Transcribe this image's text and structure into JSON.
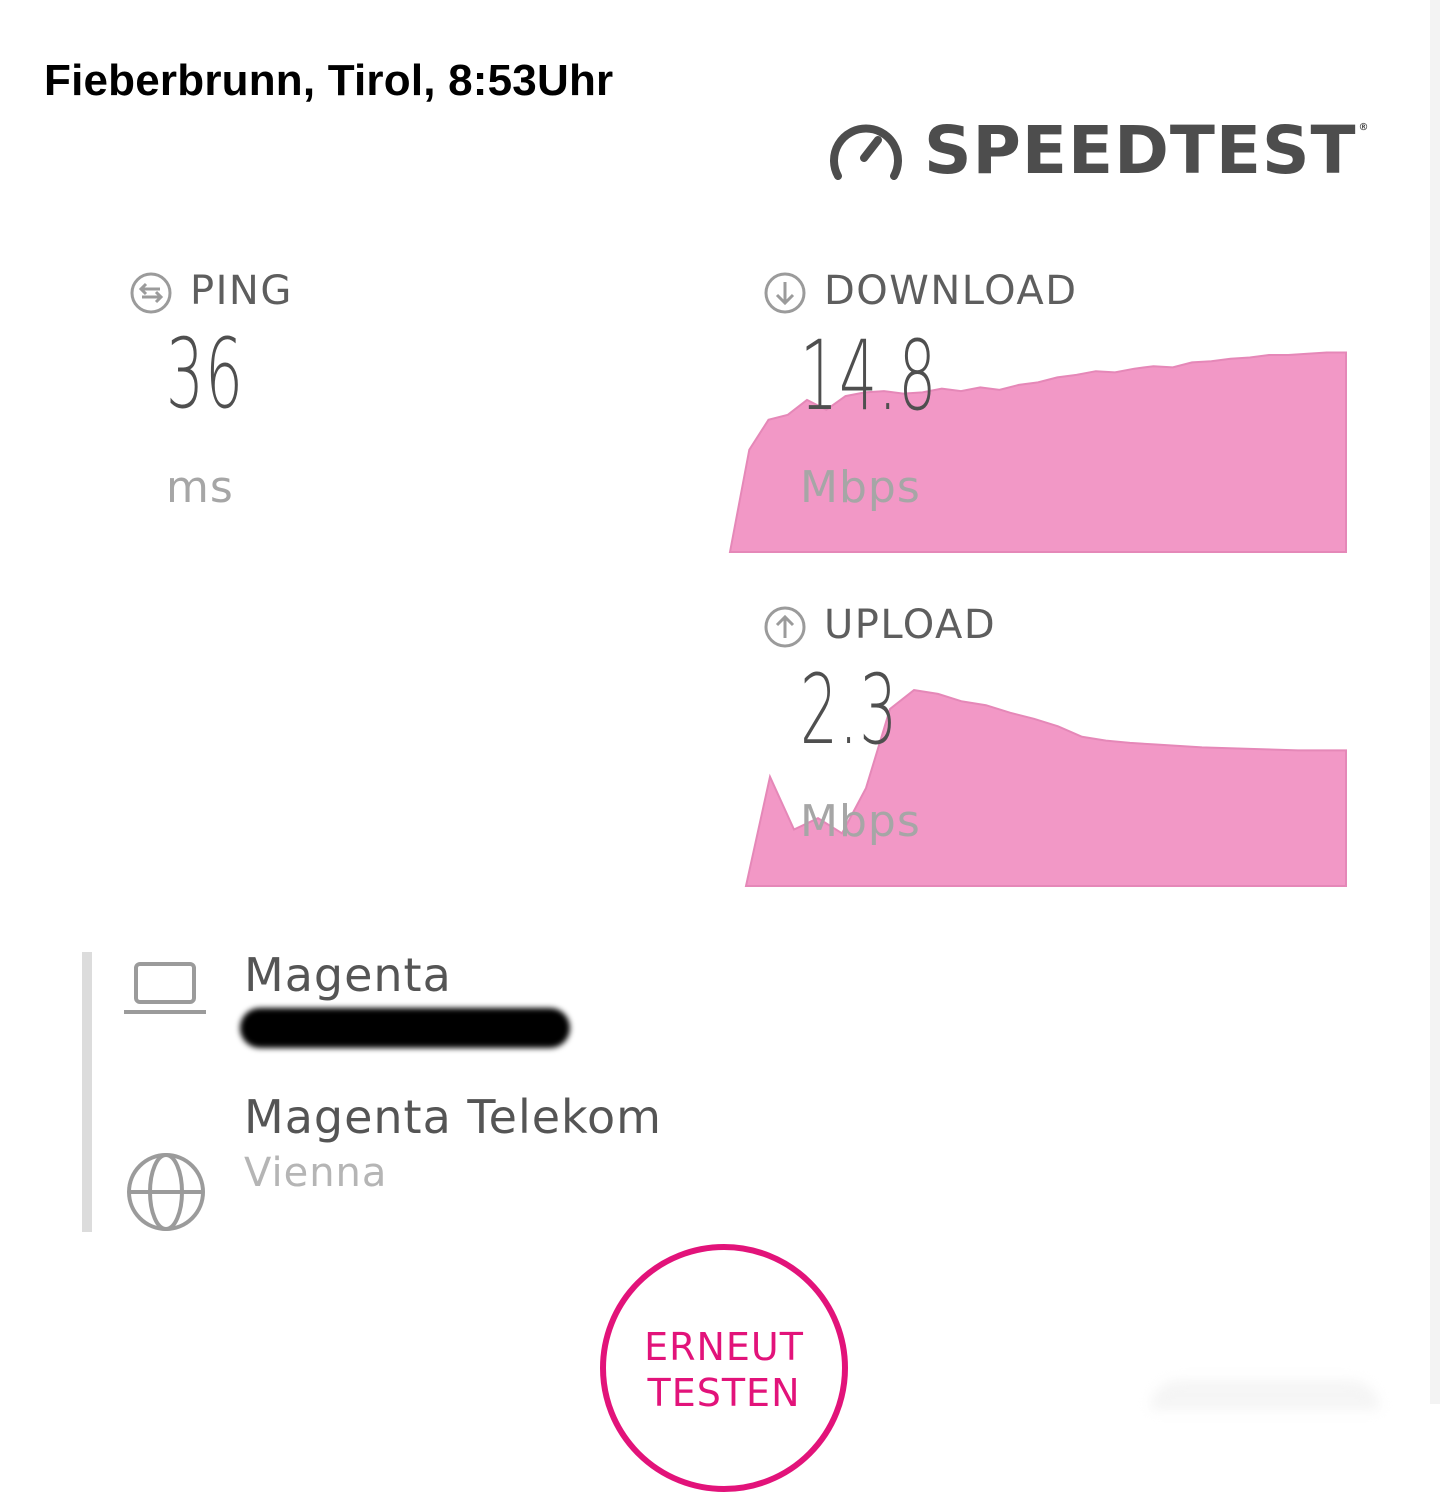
{
  "caption": "Fieberbrunn, Tirol, 8:53Uhr",
  "brand": {
    "name": "SPEEDTEST",
    "mark": "®",
    "icon": "gauge-icon"
  },
  "ping": {
    "label": "PING",
    "value": "36",
    "unit": "ms",
    "icon": "ping-arrows-icon"
  },
  "download": {
    "label": "DOWNLOAD",
    "value": "14.8",
    "unit": "Mbps",
    "icon": "arrow-down-circle-icon",
    "graph": [
      0,
      8.2,
      10.6,
      11.0,
      12.2,
      11.4,
      12.5,
      12.8,
      12.9,
      12.7,
      12.8,
      13.1,
      12.9,
      13.2,
      13.0,
      13.4,
      13.6,
      14.0,
      14.2,
      14.5,
      14.4,
      14.7,
      14.9,
      14.8,
      15.2,
      15.3,
      15.5,
      15.6,
      15.8,
      15.8,
      15.9,
      16.0,
      16.0
    ]
  },
  "upload": {
    "label": "UPLOAD",
    "value": "2.3",
    "unit": "Mbps",
    "icon": "arrow-up-circle-icon",
    "graph": [
      0,
      1.45,
      0.75,
      0.9,
      0.7,
      1.3,
      2.35,
      2.6,
      2.55,
      2.45,
      2.4,
      2.3,
      2.22,
      2.12,
      1.98,
      1.93,
      1.9,
      1.88,
      1.86,
      1.84,
      1.83,
      1.82,
      1.81,
      1.8,
      1.8,
      1.8
    ]
  },
  "isp": {
    "name": "Magenta",
    "icon": "laptop-icon"
  },
  "server": {
    "name": "Magenta Telekom",
    "location": "Vienna",
    "icon": "globe-icon"
  },
  "retest_button": {
    "label_line1": "ERNEUT",
    "label_line2": "TESTEN"
  },
  "colors": {
    "accent": "#e2137a",
    "graph_fill": "#f298c6",
    "graph_stroke": "#e588b8",
    "text": "#555555"
  }
}
